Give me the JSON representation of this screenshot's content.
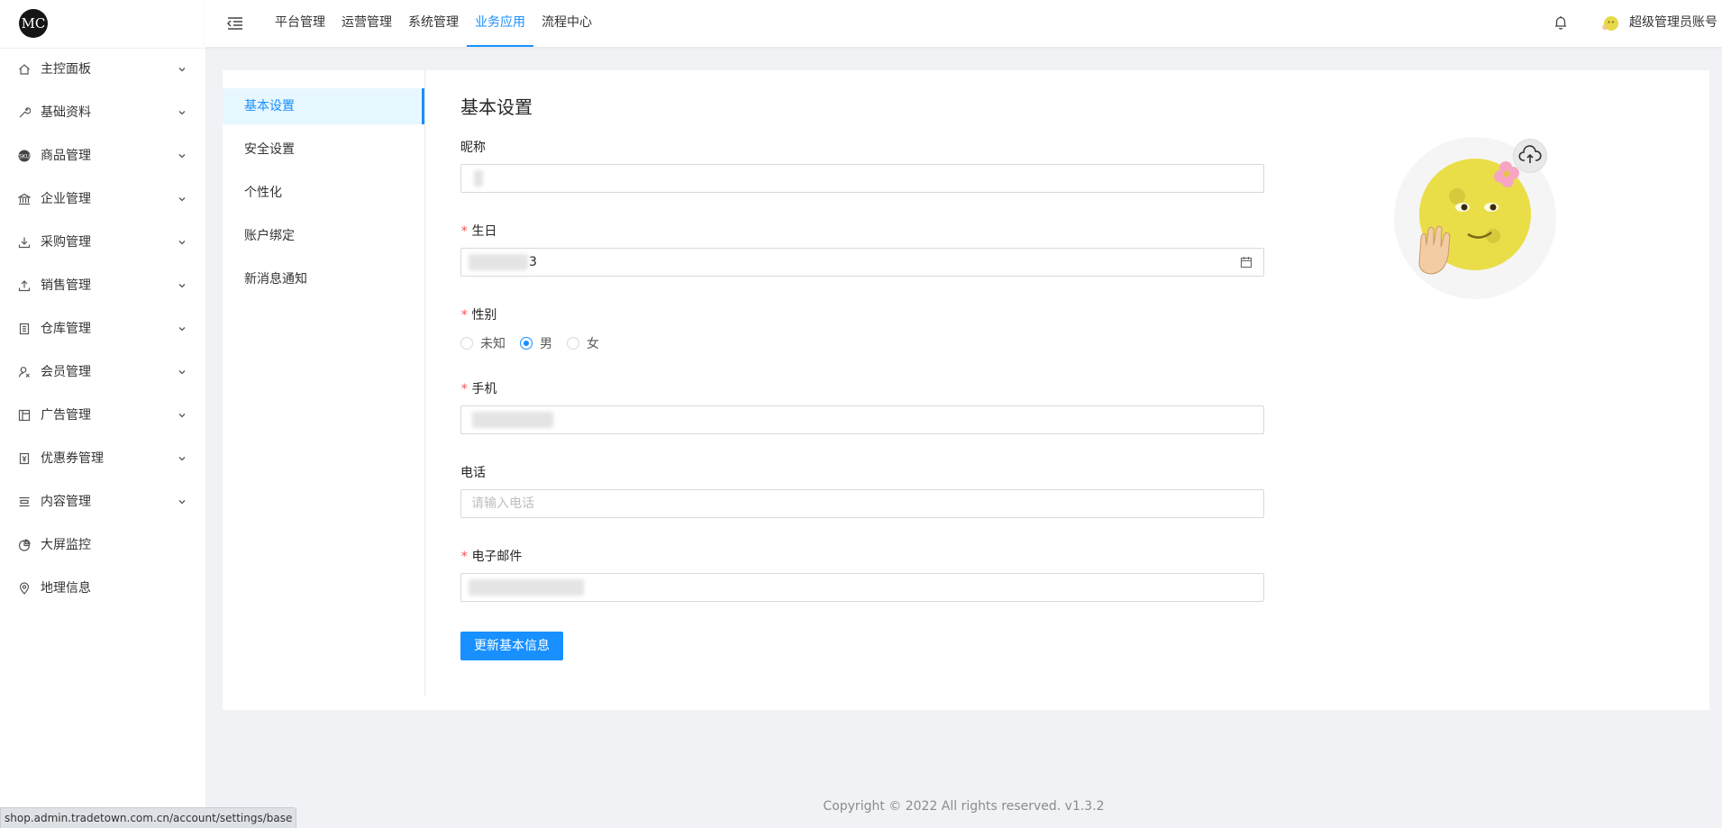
{
  "brand": {
    "logo_text": "MC"
  },
  "sidebar": {
    "items": [
      {
        "label": "主控面板",
        "icon": "home-icon",
        "expandable": true
      },
      {
        "label": "基础资料",
        "icon": "wrench-icon",
        "expandable": true
      },
      {
        "label": "商品管理",
        "icon": "goods-icon",
        "expandable": true
      },
      {
        "label": "企业管理",
        "icon": "bank-icon",
        "expandable": true
      },
      {
        "label": "采购管理",
        "icon": "download-icon",
        "expandable": true
      },
      {
        "label": "销售管理",
        "icon": "upload-icon",
        "expandable": true
      },
      {
        "label": "仓库管理",
        "icon": "container-icon",
        "expandable": true
      },
      {
        "label": "会员管理",
        "icon": "user-icon",
        "expandable": true
      },
      {
        "label": "广告管理",
        "icon": "layout-icon",
        "expandable": true
      },
      {
        "label": "优惠券管理",
        "icon": "coupon-icon",
        "expandable": true
      },
      {
        "label": "内容管理",
        "icon": "content-icon",
        "expandable": true
      },
      {
        "label": "大屏监控",
        "icon": "pie-chart-icon",
        "expandable": false
      },
      {
        "label": "地理信息",
        "icon": "location-icon",
        "expandable": false
      }
    ]
  },
  "header": {
    "tabs": [
      {
        "label": "平台管理",
        "active": false
      },
      {
        "label": "运营管理",
        "active": false
      },
      {
        "label": "系统管理",
        "active": false
      },
      {
        "label": "业务应用",
        "active": true
      },
      {
        "label": "流程中心",
        "active": false
      }
    ],
    "username": "超级管理员账号"
  },
  "settings_menu": {
    "items": [
      {
        "label": "基本设置",
        "active": true
      },
      {
        "label": "安全设置",
        "active": false
      },
      {
        "label": "个性化",
        "active": false
      },
      {
        "label": "账户绑定",
        "active": false
      },
      {
        "label": "新消息通知",
        "active": false
      }
    ]
  },
  "form": {
    "title": "基本设置",
    "nickname": {
      "label": "昵称",
      "value": ""
    },
    "birthday": {
      "label": "生日",
      "value": "3"
    },
    "gender": {
      "label": "性别",
      "options": [
        "未知",
        "男",
        "女"
      ],
      "selected": "男"
    },
    "mobile": {
      "label": "手机",
      "value": ""
    },
    "phone": {
      "label": "电话",
      "value": "",
      "placeholder": "请输入电话"
    },
    "email": {
      "label": "电子邮件",
      "value": ""
    },
    "submit_label": "更新基本信息"
  },
  "footer": {
    "copyright": "Copyright © 2022 All rights reserved. v1.3.2"
  },
  "status_bar": {
    "url": "shop.admin.tradetown.com.cn/account/settings/base"
  },
  "colors": {
    "primary": "#1890ff",
    "required": "#ff4d4f",
    "page_bg": "#f0f2f5"
  }
}
